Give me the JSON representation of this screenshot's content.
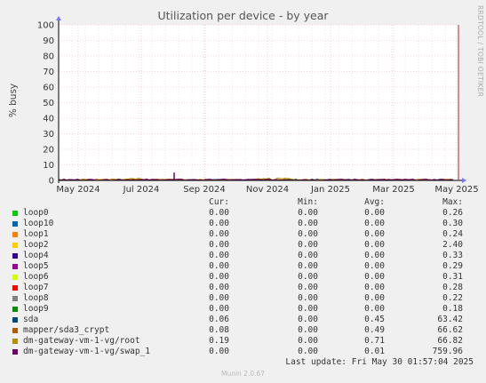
{
  "title": "Utilization per device - by year",
  "side_label": "RRDTOOL / TOBI OETIKER",
  "chart_data": {
    "type": "area",
    "ylabel": "% busy",
    "ylim": [
      0,
      100
    ],
    "yticks": [
      "0",
      "10",
      "20",
      "30",
      "40",
      "50",
      "60",
      "70",
      "80",
      "90",
      "100"
    ],
    "xticks": [
      "May 2024",
      "Jul 2024",
      "Sep 2024",
      "Nov 2024",
      "Jan 2025",
      "Mar 2025",
      "May 2025"
    ],
    "grid": true
  },
  "legend_headers": {
    "cur": "Cur:",
    "min": "Min:",
    "avg": "Avg:",
    "max": "Max:"
  },
  "legend": [
    {
      "name": "loop0",
      "color": "#00cc00",
      "cur": "0.00",
      "min": "0.00",
      "avg": "0.00",
      "max": "0.26"
    },
    {
      "name": "loop10",
      "color": "#0066b3",
      "cur": "0.00",
      "min": "0.00",
      "avg": "0.00",
      "max": "0.30"
    },
    {
      "name": "loop1",
      "color": "#ff8000",
      "cur": "0.00",
      "min": "0.00",
      "avg": "0.00",
      "max": "0.24"
    },
    {
      "name": "loop2",
      "color": "#ffcc00",
      "cur": "0.00",
      "min": "0.00",
      "avg": "0.00",
      "max": "2.40"
    },
    {
      "name": "loop4",
      "color": "#330099",
      "cur": "0.00",
      "min": "0.00",
      "avg": "0.00",
      "max": "0.33"
    },
    {
      "name": "loop5",
      "color": "#990099",
      "cur": "0.00",
      "min": "0.00",
      "avg": "0.00",
      "max": "0.29"
    },
    {
      "name": "loop6",
      "color": "#ccff00",
      "cur": "0.00",
      "min": "0.00",
      "avg": "0.00",
      "max": "0.31"
    },
    {
      "name": "loop7",
      "color": "#ff0000",
      "cur": "0.00",
      "min": "0.00",
      "avg": "0.00",
      "max": "0.28"
    },
    {
      "name": "loop8",
      "color": "#808080",
      "cur": "0.00",
      "min": "0.00",
      "avg": "0.00",
      "max": "0.22"
    },
    {
      "name": "loop9",
      "color": "#008f00",
      "cur": "0.00",
      "min": "0.00",
      "avg": "0.00",
      "max": "0.18"
    },
    {
      "name": "sda",
      "color": "#00487d",
      "cur": "0.06",
      "min": "0.00",
      "avg": "0.45",
      "max": "63.42"
    },
    {
      "name": "mapper/sda3_crypt",
      "color": "#b35a00",
      "cur": "0.08",
      "min": "0.00",
      "avg": "0.49",
      "max": "66.62"
    },
    {
      "name": "dm-gateway-vm-1-vg/root",
      "color": "#b38f00",
      "cur": "0.19",
      "min": "0.00",
      "avg": "0.71",
      "max": "66.82"
    },
    {
      "name": "dm-gateway-vm-1-vg/swap_1",
      "color": "#6b006b",
      "cur": "0.00",
      "min": "0.00",
      "avg": "0.01",
      "max": "759.96"
    }
  ],
  "last_update": "Last update: Fri May 30 01:57:04 2025",
  "munin_version": "Munin 2.0.67"
}
